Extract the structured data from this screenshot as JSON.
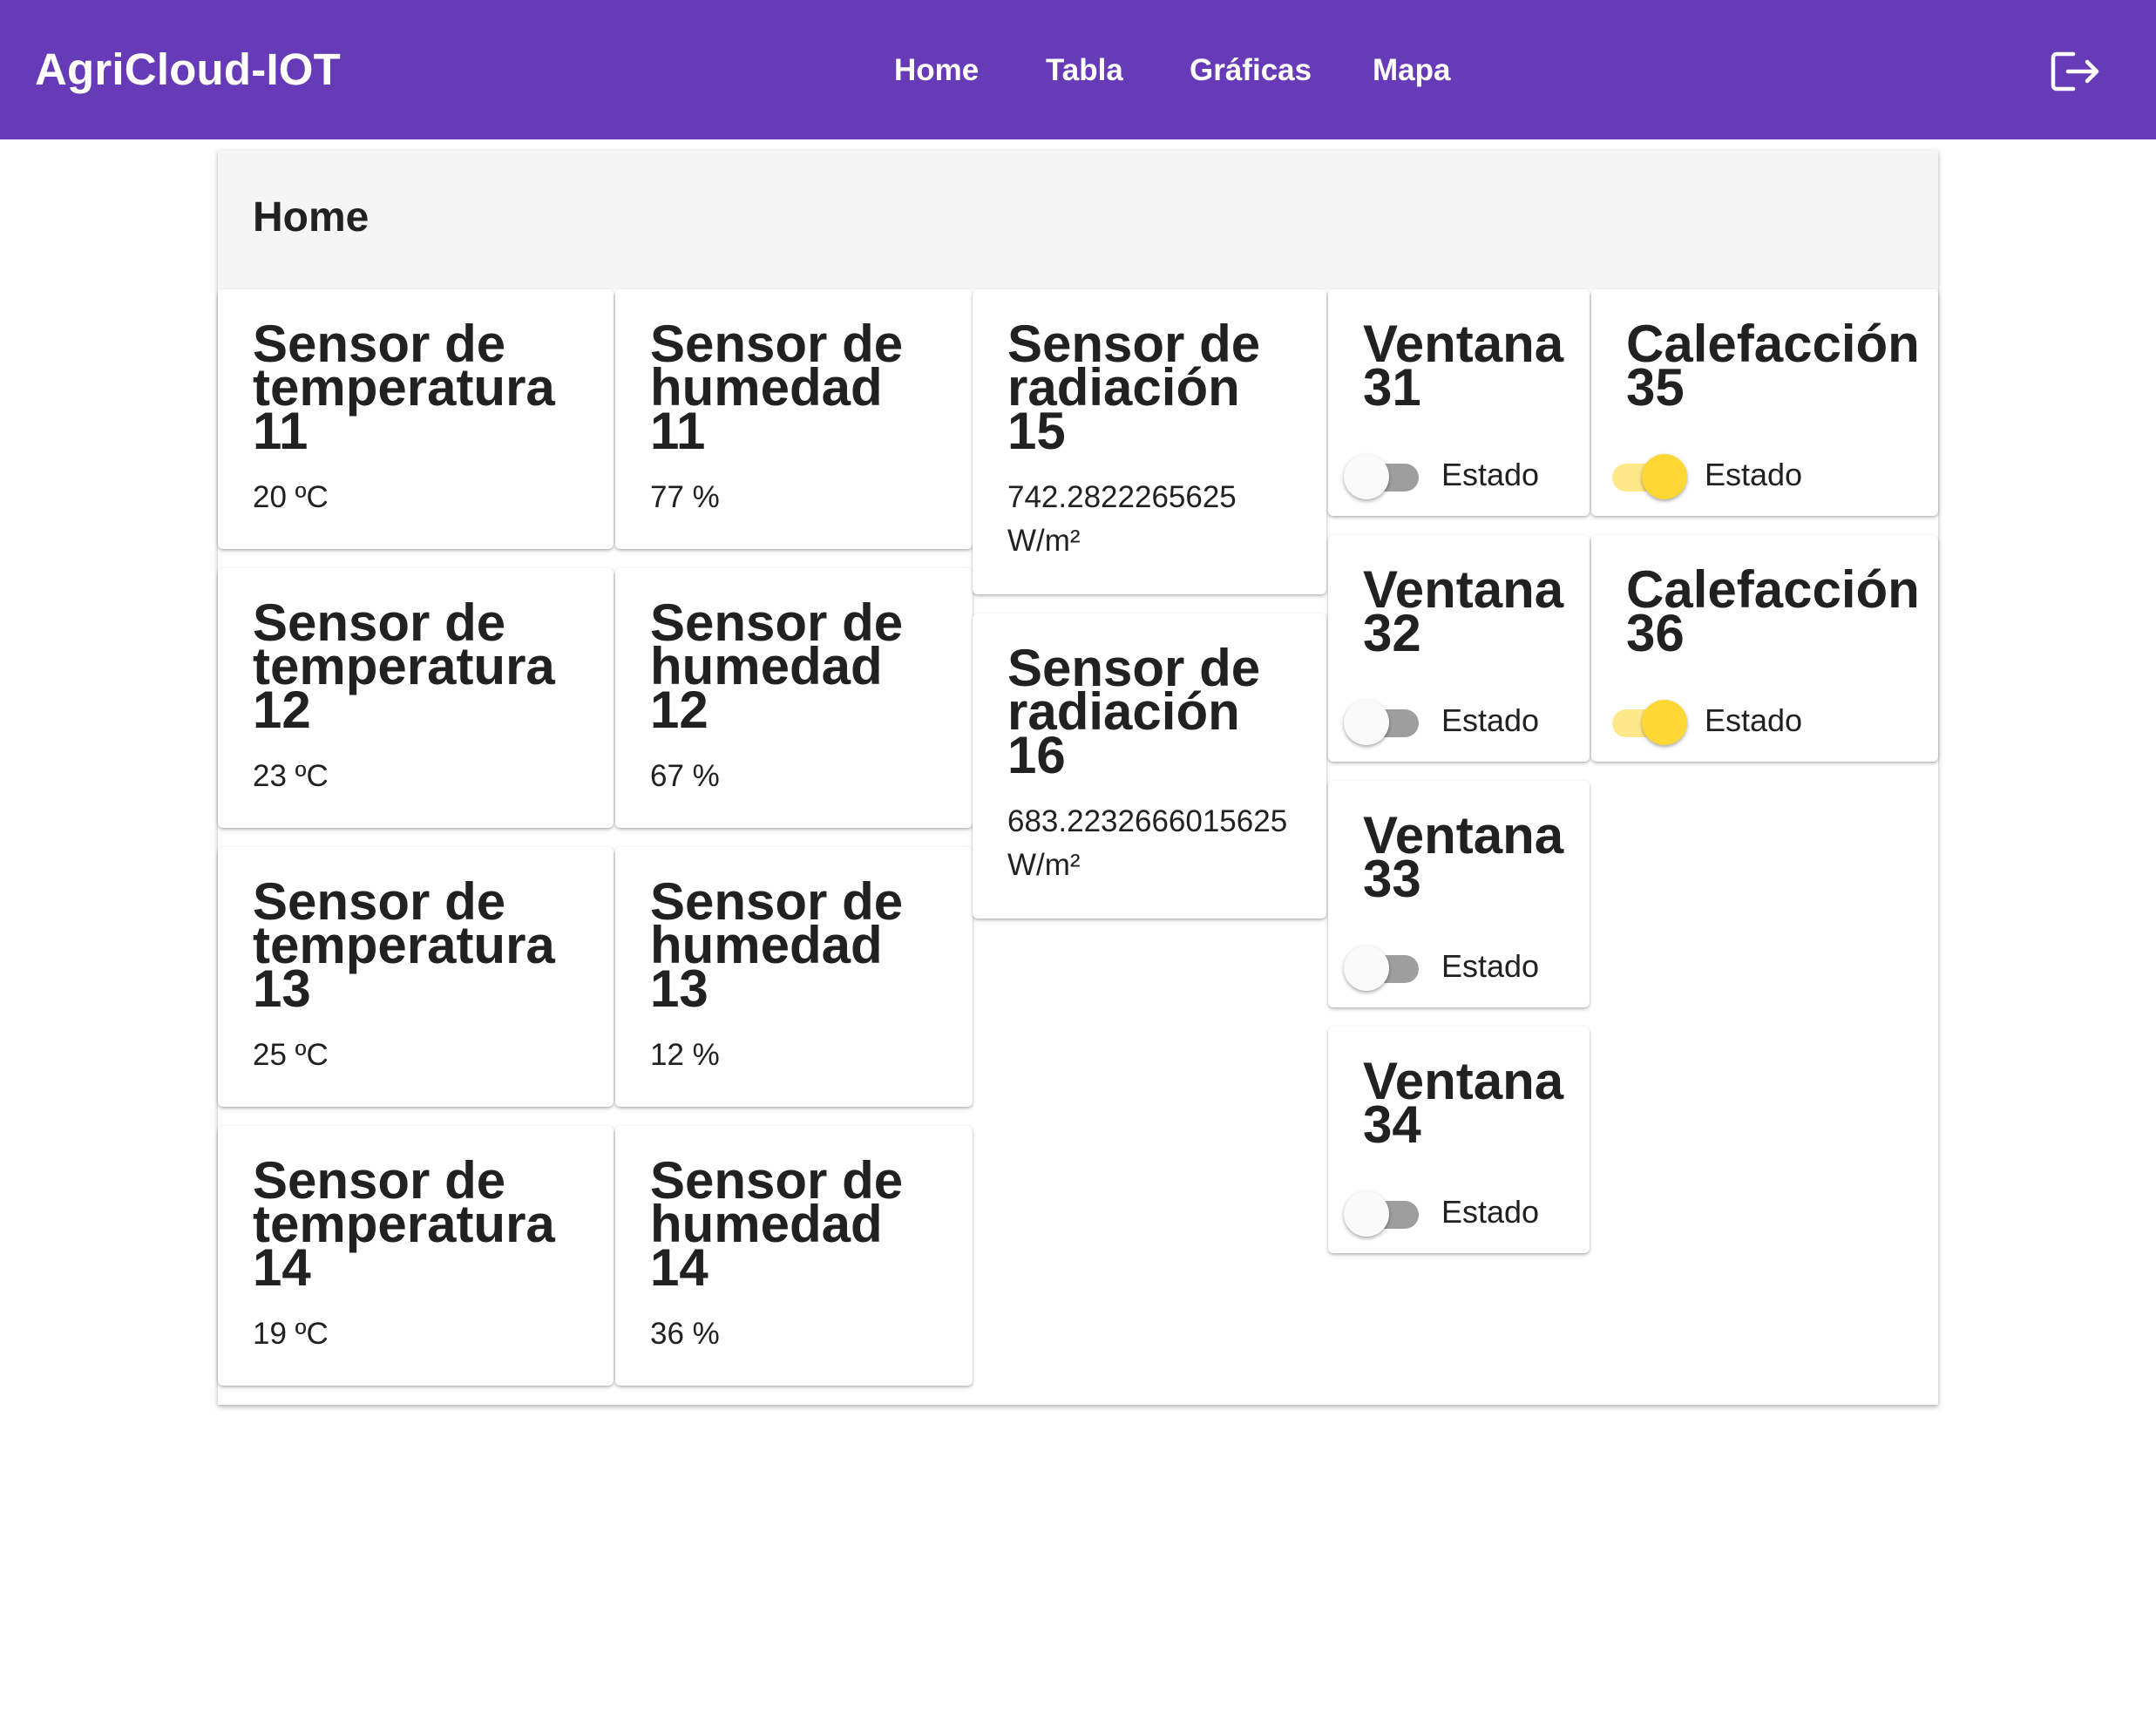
{
  "colors": {
    "brand": "#673ab7",
    "switch_on": "#fdd835",
    "switch_off": "#9e9e9e"
  },
  "app": {
    "title": "AgriCloud-IOT"
  },
  "nav": {
    "home": "Home",
    "tabla": "Tabla",
    "graficas": "Gráficas",
    "mapa": "Mapa"
  },
  "icons": {
    "logout": "logout-icon"
  },
  "page": {
    "title": "Home"
  },
  "temperature_sensors": [
    {
      "name": [
        "Sensor de",
        "temperatura",
        "11"
      ],
      "value": "20 ºC"
    },
    {
      "name": [
        "Sensor de",
        "temperatura",
        "12"
      ],
      "value": "23 ºC"
    },
    {
      "name": [
        "Sensor de",
        "temperatura",
        "13"
      ],
      "value": "25 ºC"
    },
    {
      "name": [
        "Sensor de",
        "temperatura",
        "14"
      ],
      "value": "19 ºC"
    }
  ],
  "humidity_sensors": [
    {
      "name": [
        "Sensor de",
        "humedad",
        "11"
      ],
      "value": "77 %"
    },
    {
      "name": [
        "Sensor de",
        "humedad",
        "12"
      ],
      "value": "67 %"
    },
    {
      "name": [
        "Sensor de",
        "humedad",
        "13"
      ],
      "value": "12 %"
    },
    {
      "name": [
        "Sensor de",
        "humedad",
        "14"
      ],
      "value": "36 %"
    }
  ],
  "radiation_sensors": [
    {
      "name": [
        "Sensor de",
        "radiación",
        "15"
      ],
      "value": [
        "742.2822265625",
        "W/m²"
      ]
    },
    {
      "name": [
        "Sensor de",
        "radiación",
        "16"
      ],
      "value": [
        "683.2232666015625",
        "W/m²"
      ]
    }
  ],
  "windows": [
    {
      "name": [
        "Ventana",
        "31"
      ],
      "label": "Estado",
      "on": false
    },
    {
      "name": [
        "Ventana",
        "32"
      ],
      "label": "Estado",
      "on": false
    },
    {
      "name": [
        "Ventana",
        "33"
      ],
      "label": "Estado",
      "on": false
    },
    {
      "name": [
        "Ventana",
        "34"
      ],
      "label": "Estado",
      "on": false
    }
  ],
  "heaters": [
    {
      "name": [
        "Calefacción",
        "35"
      ],
      "label": "Estado",
      "on": true
    },
    {
      "name": [
        "Calefacción",
        "36"
      ],
      "label": "Estado",
      "on": true
    }
  ]
}
